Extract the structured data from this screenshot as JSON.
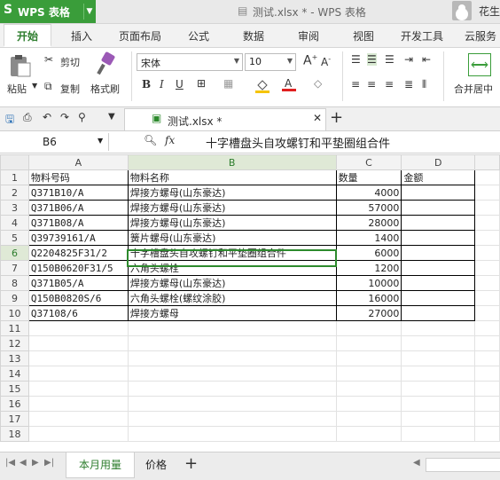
{
  "app": {
    "logo": "S",
    "name": "WPS 表格",
    "doc_title": "测试.xlsx * - WPS 表格",
    "user": "花生"
  },
  "ribbon_tabs": [
    "开始",
    "插入",
    "页面布局",
    "公式",
    "数据",
    "审阅",
    "视图",
    "开发工具",
    "云服务"
  ],
  "ribbon": {
    "paste": "粘贴",
    "cut": "剪切",
    "copy": "复制",
    "format_painter": "格式刷",
    "font_name": "宋体",
    "font_size": "10",
    "merge_center": "合并居中"
  },
  "doc_tab": {
    "label": "测试.xlsx *"
  },
  "formula_bar": {
    "cell_ref": "B6",
    "fx": "fx",
    "content": "十字槽盘头自攻螺钉和平垫圈组合件"
  },
  "columns": [
    "A",
    "B",
    "C",
    "D"
  ],
  "active": {
    "row": 6,
    "col": "B"
  },
  "rows": [
    {
      "n": "1",
      "a": "物料号码",
      "b": "物料名称",
      "c": "数量",
      "d": "金额"
    },
    {
      "n": "2",
      "a": "Q371B10/A",
      "b": "焊接方螺母(山东豪达)",
      "c": "4000",
      "d": ""
    },
    {
      "n": "3",
      "a": "Q371B06/A",
      "b": "焊接方螺母(山东豪达)",
      "c": "57000",
      "d": ""
    },
    {
      "n": "4",
      "a": "Q371B08/A",
      "b": "焊接方螺母(山东豪达)",
      "c": "28000",
      "d": ""
    },
    {
      "n": "5",
      "a": "Q39739161/A",
      "b": "簧片螺母(山东豪达)",
      "c": "1400",
      "d": ""
    },
    {
      "n": "6",
      "a": "Q2204825F31/2",
      "b": "十字槽盘头自攻螺钉和平垫圈组合件",
      "c": "6000",
      "d": ""
    },
    {
      "n": "7",
      "a": "Q150B0620F31/5",
      "b": "六角头螺栓",
      "c": "1200",
      "d": ""
    },
    {
      "n": "8",
      "a": "Q371B05/A",
      "b": "焊接方螺母(山东豪达)",
      "c": "10000",
      "d": ""
    },
    {
      "n": "9",
      "a": "Q150B0820S/6",
      "b": "六角头螺栓(螺纹涂胶)",
      "c": "16000",
      "d": ""
    },
    {
      "n": "10",
      "a": "Q37108/6",
      "b": "焊接方螺母",
      "c": "27000",
      "d": ""
    },
    {
      "n": "11",
      "a": "",
      "b": "",
      "c": "",
      "d": ""
    },
    {
      "n": "12",
      "a": "",
      "b": "",
      "c": "",
      "d": ""
    },
    {
      "n": "13",
      "a": "",
      "b": "",
      "c": "",
      "d": ""
    },
    {
      "n": "14",
      "a": "",
      "b": "",
      "c": "",
      "d": ""
    },
    {
      "n": "15",
      "a": "",
      "b": "",
      "c": "",
      "d": ""
    },
    {
      "n": "16",
      "a": "",
      "b": "",
      "c": "",
      "d": ""
    },
    {
      "n": "17",
      "a": "",
      "b": "",
      "c": "",
      "d": ""
    },
    {
      "n": "18",
      "a": "",
      "b": "",
      "c": "",
      "d": ""
    }
  ],
  "sheet_tabs": [
    "本月用量",
    "价格"
  ],
  "colors": {
    "accent": "#3a9d3a",
    "active_cell": "#2d8a2d"
  }
}
